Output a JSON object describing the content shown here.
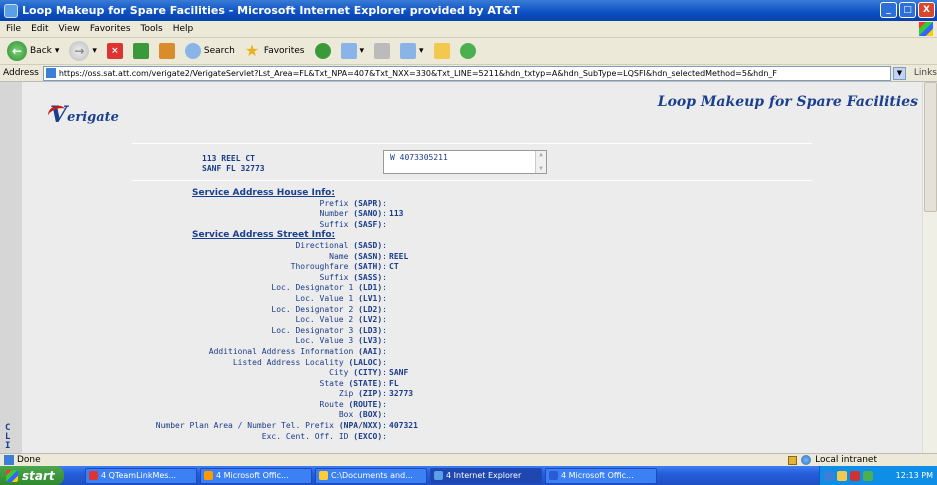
{
  "window": {
    "title": "Loop Makeup for Spare Facilities - Microsoft Internet Explorer provided by AT&T",
    "buttons": [
      "_",
      "□",
      "X"
    ]
  },
  "menubar": [
    "File",
    "Edit",
    "View",
    "Favorites",
    "Tools",
    "Help"
  ],
  "toolbar": {
    "back": "Back",
    "search": "Search",
    "favorites": "Favorites"
  },
  "address": {
    "label": "Address",
    "url": "https://oss.sat.att.com/verigate2/VerigateServlet?Lst_Area=FL&Txt_NPA=407&Txt_NXX=330&Txt_LINE=5211&hdn_txtyp=A&hdn_SubType=LQSFI&hdn_selectedMethod=5&hdn_F",
    "links": "Links"
  },
  "page": {
    "logo_v": "V",
    "logo_rest": "erigate",
    "title": "Loop Makeup for Spare Facilities",
    "address_line1": "113 REEL CT",
    "address_line2": "SANF FL 32773",
    "tn_value": "W 4073305211",
    "left_letters": [
      "C",
      "L",
      "I"
    ]
  },
  "rows": [
    {
      "type": "head",
      "text": "Service Address House Info:"
    },
    {
      "label": "Prefix ",
      "code": "(SAPR)",
      "value": ""
    },
    {
      "label": "Number ",
      "code": "(SANO)",
      "value": "113"
    },
    {
      "label": "Suffix ",
      "code": "(SASF)",
      "value": ""
    },
    {
      "type": "head",
      "text": "Service Address Street Info:"
    },
    {
      "label": "Directional ",
      "code": "(SASD)",
      "value": ""
    },
    {
      "label": "Name ",
      "code": "(SASN)",
      "value": "REEL"
    },
    {
      "label": "Thoroughfare ",
      "code": "(SATH)",
      "value": "CT"
    },
    {
      "label": "Suffix ",
      "code": "(SASS)",
      "value": ""
    },
    {
      "label": "Loc. Designator 1 ",
      "code": "(LD1)",
      "value": ""
    },
    {
      "label": "Loc. Value 1 ",
      "code": "(LV1)",
      "value": ""
    },
    {
      "label": "Loc. Designator 2 ",
      "code": "(LD2)",
      "value": ""
    },
    {
      "label": "Loc. Value 2 ",
      "code": "(LV2)",
      "value": ""
    },
    {
      "label": "Loc. Designator 3 ",
      "code": "(LD3)",
      "value": ""
    },
    {
      "label": "Loc. Value 3 ",
      "code": "(LV3)",
      "value": ""
    },
    {
      "label": "Additional Address Information ",
      "code": "(AAI)",
      "value": ""
    },
    {
      "label": "Listed Address Locality ",
      "code": "(LALOC)",
      "value": ""
    },
    {
      "label": "City ",
      "code": "(CITY)",
      "value": "SANF"
    },
    {
      "label": "State ",
      "code": "(STATE)",
      "value": "FL"
    },
    {
      "label": "Zip ",
      "code": "(ZIP)",
      "value": "32773"
    },
    {
      "label": "Route ",
      "code": "(ROUTE)",
      "value": ""
    },
    {
      "label": "Box ",
      "code": "(BOX)",
      "value": ""
    },
    {
      "label": "Number Plan Area / Number Tel. Prefix ",
      "code": "(NPA/NXX)",
      "value": "407321"
    },
    {
      "label": "Exc. Cent. Off. ID ",
      "code": "(EXCO)",
      "value": ""
    }
  ],
  "status": {
    "text": "Done",
    "zone": "Local intranet"
  },
  "taskbar": {
    "start": "start",
    "tasks": [
      {
        "label": "4 QTeamLinkMes...",
        "color": "#d33"
      },
      {
        "label": "4 Microsoft Offic...",
        "color": "#f90"
      },
      {
        "label": "C:\\Documents and...",
        "color": "#fc3"
      },
      {
        "label": "4 Internet Explorer",
        "color": "#5aa0e6"
      },
      {
        "label": "4 Microsoft Offic...",
        "color": "#2a5bd7"
      }
    ],
    "clock": "12:13 PM"
  }
}
